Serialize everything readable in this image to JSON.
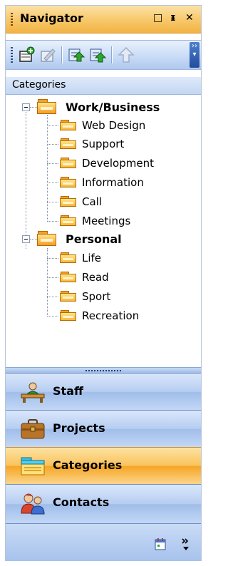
{
  "window": {
    "title": "Navigator"
  },
  "title_buttons": {
    "restore": "□",
    "pin": "ᵻ",
    "close": "✕"
  },
  "panel": {
    "header": "Categories"
  },
  "tree": {
    "roots": [
      {
        "label": "Work/Business",
        "children": [
          "Web Design",
          "Support",
          "Development",
          "Information",
          "Call",
          "Meetings"
        ]
      },
      {
        "label": "Personal",
        "children": [
          "Life",
          "Read",
          "Sport",
          "Recreation"
        ]
      }
    ]
  },
  "nav": {
    "buttons": [
      {
        "label": "Staff",
        "icon": "desk-icon",
        "active": false
      },
      {
        "label": "Projects",
        "icon": "briefcase-icon",
        "active": false
      },
      {
        "label": "Categories",
        "icon": "categories-icon",
        "active": true
      },
      {
        "label": "Contacts",
        "icon": "contacts-icon",
        "active": false
      }
    ]
  },
  "colors": {
    "active_accent": "#f6a523",
    "nav_blue": "#b6cdf1",
    "title_orange": "#f7c769"
  }
}
